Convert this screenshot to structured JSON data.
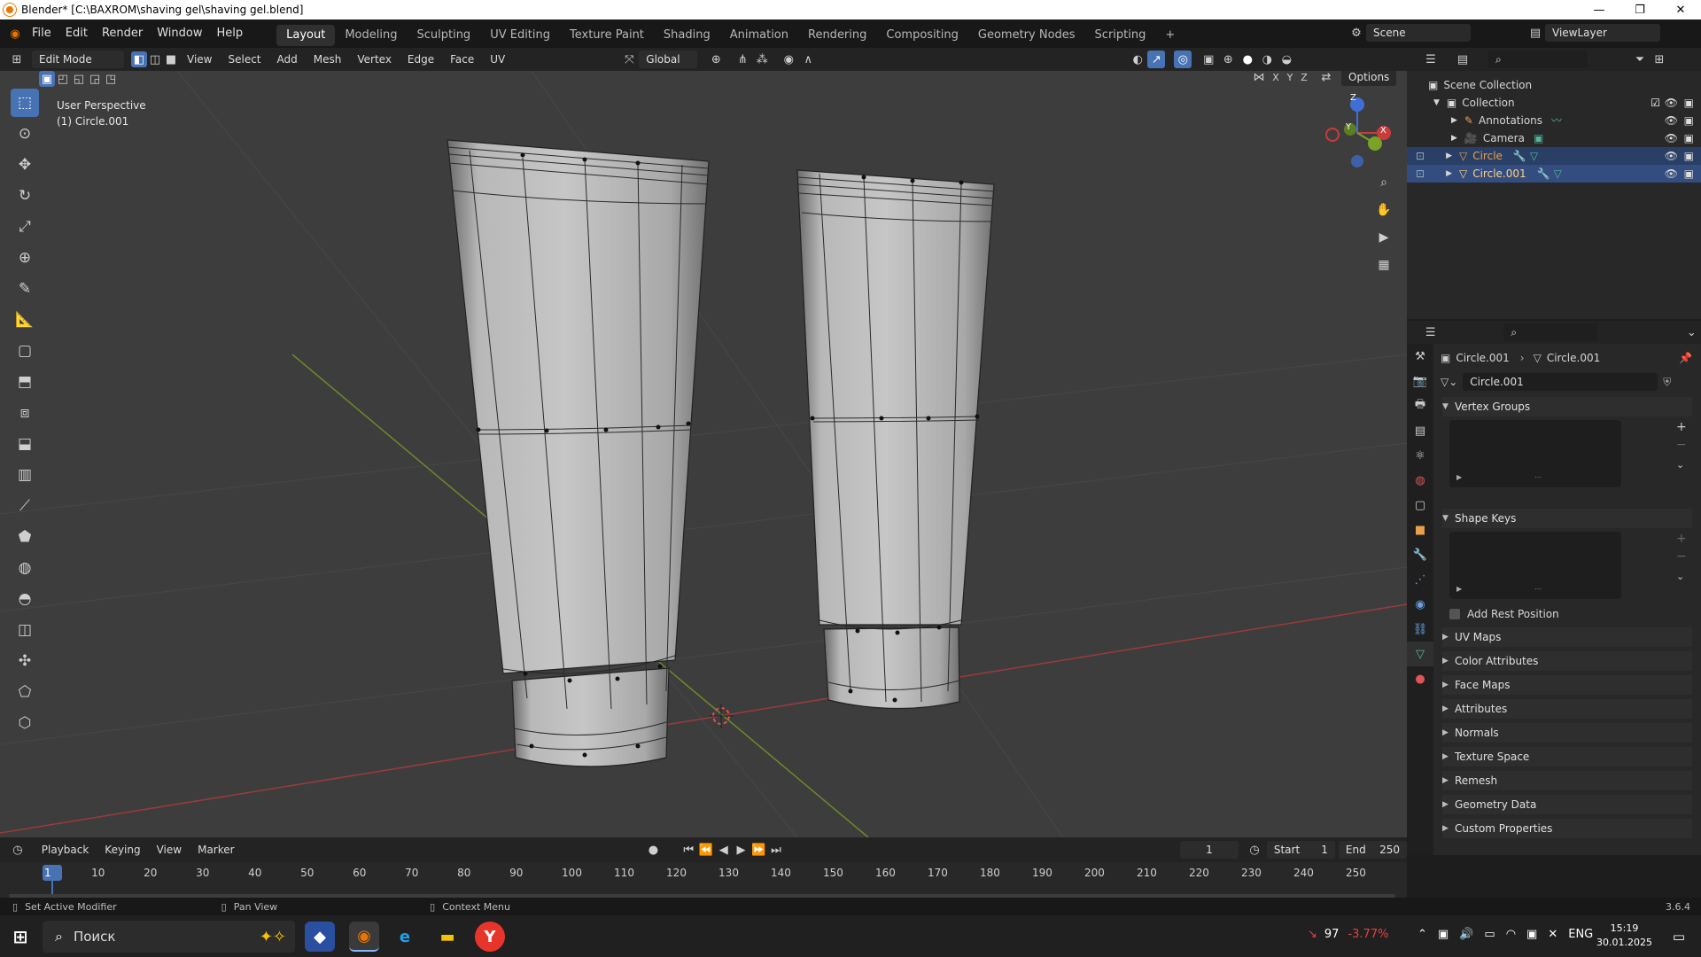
{
  "window": {
    "title": "Blender* [C:\\BAXROM\\shaving gel\\shaving gel.blend]",
    "minimize": "—",
    "maximize": "❐",
    "close": "✕"
  },
  "menu": {
    "file": "File",
    "edit": "Edit",
    "render": "Render",
    "window": "Window",
    "help": "Help"
  },
  "workspaces": [
    "Layout",
    "Modeling",
    "Sculpting",
    "UV Editing",
    "Texture Paint",
    "Shading",
    "Animation",
    "Rendering",
    "Compositing",
    "Geometry Nodes",
    "Scripting"
  ],
  "scene": {
    "name": "Scene",
    "view_layer": "ViewLayer"
  },
  "viewport_header": {
    "mode": "Edit Mode",
    "menus": [
      "View",
      "Select",
      "Add",
      "Mesh",
      "Vertex",
      "Edge",
      "Face",
      "UV"
    ],
    "transform_orientation": "Global",
    "options": "Options",
    "axes": [
      "X",
      "Y",
      "Z"
    ]
  },
  "viewport": {
    "perspective": "User Perspective",
    "object": "(1) Circle.001",
    "gizmo": {
      "x": "X",
      "y": "Y",
      "z": "Z"
    }
  },
  "outliner": {
    "root": "Scene Collection",
    "collection": "Collection",
    "items": [
      {
        "name": "Annotations",
        "color": "#d0d0d0"
      },
      {
        "name": "Camera",
        "color": "#d0d0d0"
      },
      {
        "name": "Circle",
        "color": "#e8a04a"
      },
      {
        "name": "Circle.001",
        "color": "#ffd080"
      }
    ]
  },
  "properties": {
    "breadcrumb_object": "Circle.001",
    "breadcrumb_data": "Circle.001",
    "mesh_name": "Circle.001",
    "panels": {
      "vertex_groups": "Vertex Groups",
      "shape_keys": "Shape Keys",
      "add_rest_position": "Add Rest Position",
      "collapsed": [
        "UV Maps",
        "Color Attributes",
        "Face Maps",
        "Attributes",
        "Normals",
        "Texture Space",
        "Remesh",
        "Geometry Data",
        "Custom Properties"
      ]
    }
  },
  "timeline": {
    "playback": "Playback",
    "keying": "Keying",
    "view": "View",
    "marker": "Marker",
    "current_frame": "1",
    "start_label": "Start",
    "start": "1",
    "end_label": "End",
    "end": "250",
    "ticks": [
      "1",
      "10",
      "20",
      "30",
      "40",
      "50",
      "60",
      "70",
      "80",
      "90",
      "100",
      "110",
      "120",
      "130",
      "140",
      "150",
      "160",
      "170",
      "180",
      "190",
      "200",
      "210",
      "220",
      "230",
      "240",
      "250"
    ]
  },
  "status": {
    "left": "Set Active Modifier",
    "mid": "Pan View",
    "right": "Context Menu",
    "version": "3.6.4"
  },
  "taskbar": {
    "search": "Поиск",
    "stock_value": "97",
    "stock_change": "-3.77%",
    "lang": "ENG",
    "time": "15:19",
    "date": "30.01.2025"
  },
  "colors": {
    "accent": "#4772b3",
    "x_axis": "#c83c3c",
    "y_axis": "#7aa226",
    "z_axis": "#3f6fd6"
  }
}
